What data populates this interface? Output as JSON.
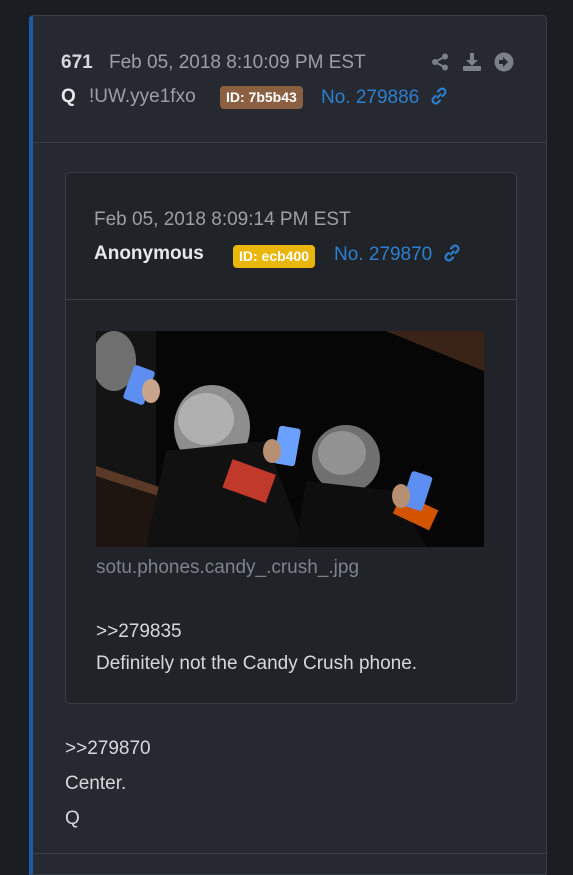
{
  "post": {
    "number": "671",
    "date": "Feb 05, 2018 8:10:09 PM EST",
    "author": "Q",
    "tripcode": "!UW.yye1fxo",
    "id_badge": "ID: 7b5b43",
    "post_no": "No. 279886",
    "reply_ref": ">>279870",
    "body_lines": [
      "Center.",
      "Q"
    ]
  },
  "quoted": {
    "date": "Feb 05, 2018 8:09:14 PM EST",
    "author": "Anonymous",
    "id_badge": "ID: ecb400",
    "post_no": "No. 279870",
    "filename": "sotu.phones.candy_.crush_.jpg",
    "reply_ref": ">>279835",
    "text": "Definitely not the Candy Crush phone."
  },
  "icons": [
    "share-icon",
    "download-icon",
    "arrow-right-circle-icon",
    "link-icon"
  ],
  "colors": {
    "accent_border": "#1f5aa6",
    "link": "#2d7fcf",
    "id_badge_q": "#8a6040",
    "id_badge_anon": "#e8b70a"
  }
}
